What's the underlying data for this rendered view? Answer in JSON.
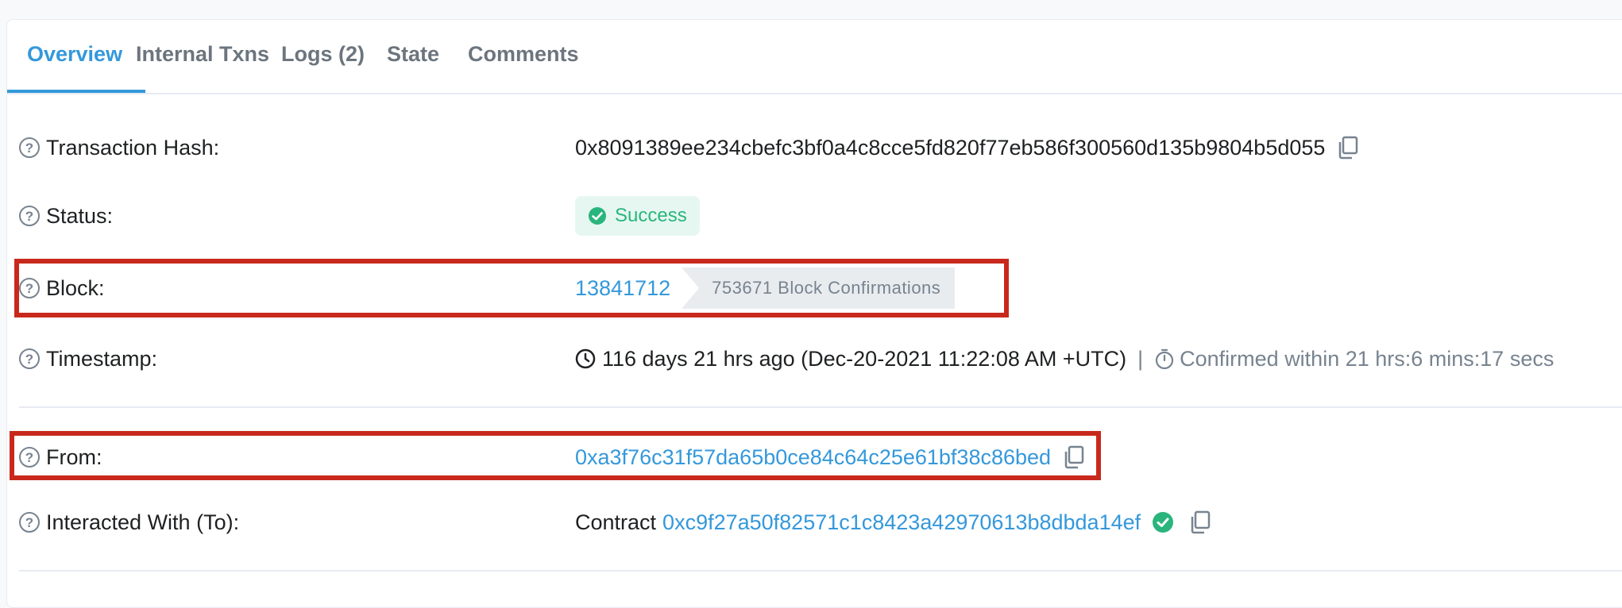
{
  "tabs": [
    {
      "label": "Overview"
    },
    {
      "label": "Internal Txns"
    },
    {
      "label": "Logs (2)"
    },
    {
      "label": "State"
    },
    {
      "label": "Comments"
    }
  ],
  "rows": {
    "tx_hash": {
      "label": "Transaction Hash:",
      "value": "0x8091389ee234cbefc3bf0a4c8cce5fd820f77eb586f300560d135b9804b5d055"
    },
    "status": {
      "label": "Status:",
      "value": "Success"
    },
    "block": {
      "label": "Block:",
      "number": "13841712",
      "confirmations": "753671 Block Confirmations"
    },
    "timestamp": {
      "label": "Timestamp:",
      "ago": "116 days 21 hrs ago (Dec-20-2021 11:22:08 AM +UTC)",
      "separator": "|",
      "confirmed": "Confirmed within 21 hrs:6 mins:17 secs"
    },
    "from": {
      "label": "From:",
      "value": "0xa3f76c31f57da65b0ce84c64c25e61bf38c86bed"
    },
    "to": {
      "label": "Interacted With (To):",
      "prefix": "Contract",
      "value": "0xc9f27a50f82571c1c8423a42970613b8dbda14ef"
    }
  },
  "icons": {
    "help": "question-circle-icon",
    "copy": "copy-icon",
    "success": "check-circle-icon",
    "clock": "clock-icon",
    "timer": "stopwatch-icon",
    "verified": "verified-check-icon"
  },
  "colors": {
    "accent": "#3498db",
    "success": "#2ab57d",
    "highlight": "#c8291c"
  }
}
